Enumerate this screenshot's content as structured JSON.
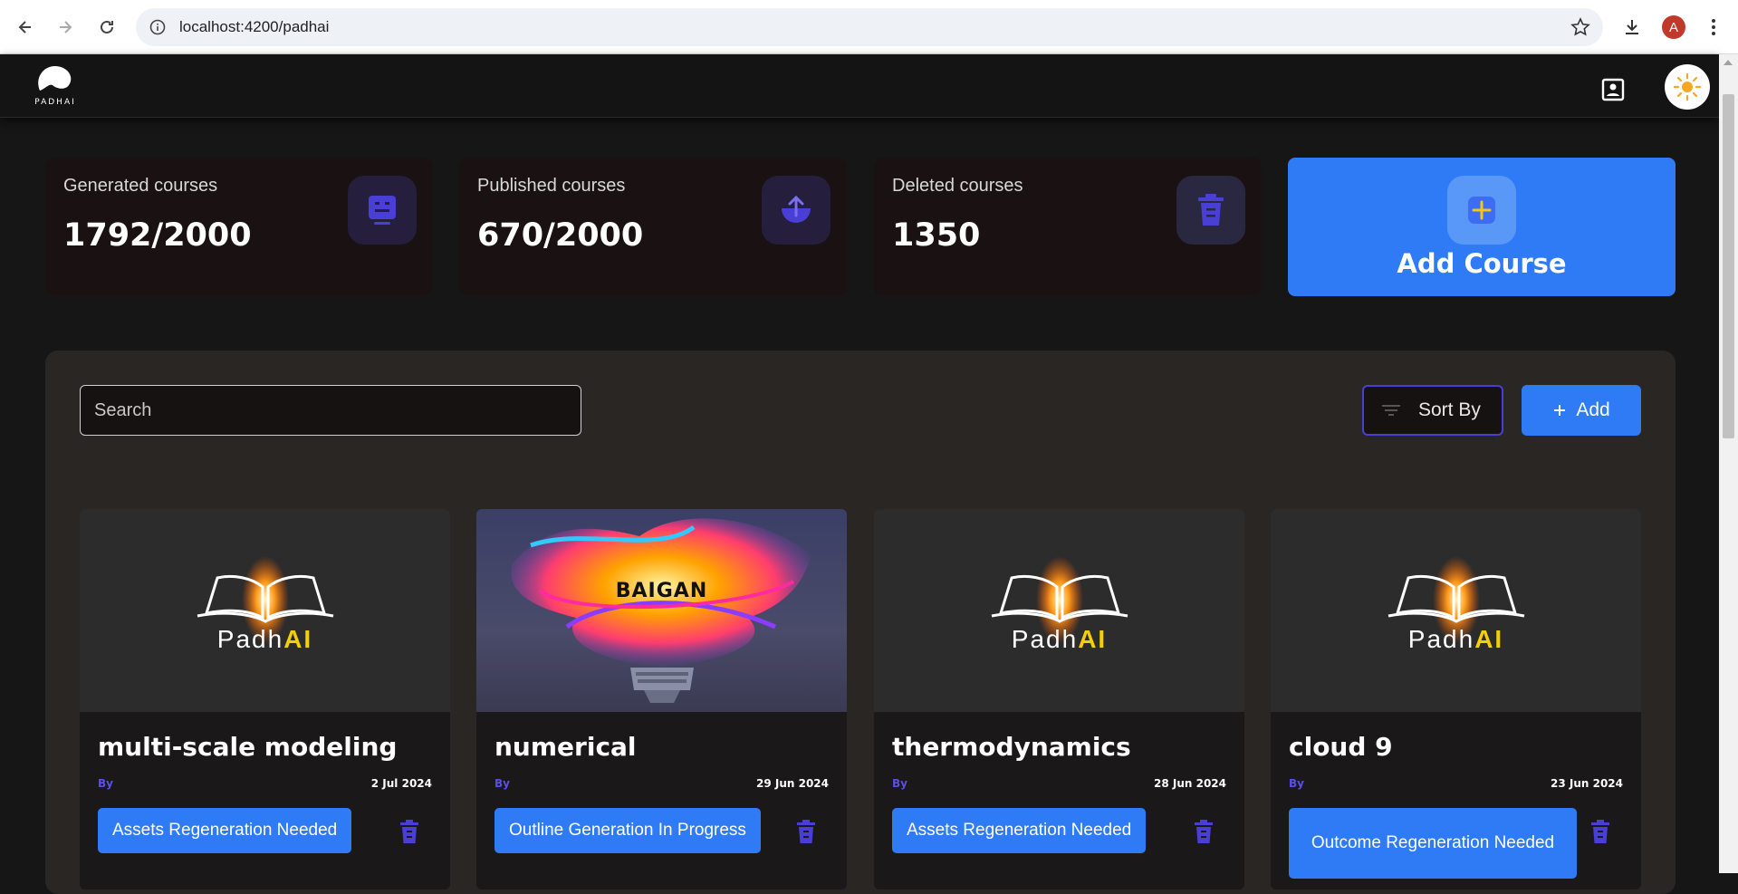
{
  "browser": {
    "url": "localhost:4200/padhai",
    "profile_initial": "A"
  },
  "header": {
    "logo_text": "PADHAI"
  },
  "stats": [
    {
      "label": "Generated courses",
      "value": "1792/2000",
      "icon": "robot-icon"
    },
    {
      "label": "Published courses",
      "value": "670/2000",
      "icon": "upload-icon"
    },
    {
      "label": "Deleted courses",
      "value": "1350",
      "icon": "trash-icon"
    }
  ],
  "add_course": {
    "label": "Add Course"
  },
  "toolbar": {
    "search_placeholder": "Search",
    "sort_label": "Sort By",
    "add_label": "Add"
  },
  "courses": [
    {
      "title": "multi-scale modeling",
      "by": "By",
      "date": "2 Jul 2024",
      "status": "Assets Regeneration Needed",
      "thumbnail": "padhai-logo"
    },
    {
      "title": "numerical",
      "by": "By",
      "date": "29 Jun 2024",
      "status": "Outline Generation In Progress",
      "thumbnail": "baigan-bulb",
      "thumbnail_text": "BAIGAN"
    },
    {
      "title": "thermodynamics",
      "by": "By",
      "date": "28 Jun 2024",
      "status": "Assets Regeneration Needed",
      "thumbnail": "padhai-logo"
    },
    {
      "title": "cloud 9",
      "by": "By",
      "date": "23 Jun 2024",
      "status": "Outcome Regeneration Needed",
      "thumbnail": "padhai-logo"
    }
  ],
  "thumbnail_logo": {
    "part1": "Padh",
    "part2": "AI"
  },
  "colors": {
    "accent": "#2f7bf5",
    "purple": "#5b4fe8",
    "background": "#161616",
    "panel": "#2a2624"
  }
}
